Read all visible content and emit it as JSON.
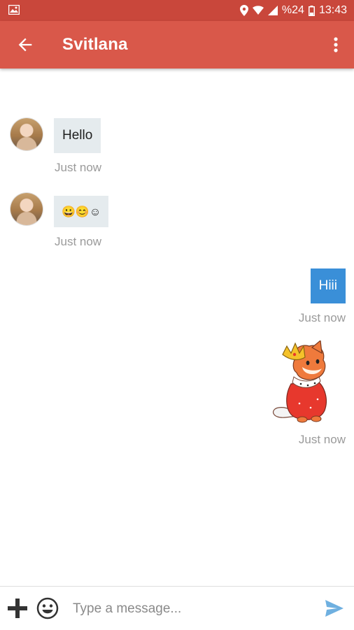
{
  "status_bar": {
    "battery": "%24",
    "time": "13:43"
  },
  "header": {
    "title": "Svitlana"
  },
  "messages": [
    {
      "direction": "in",
      "text": "Hello",
      "time": "Just now"
    },
    {
      "direction": "in",
      "text": "😀😊☺",
      "time": "Just now"
    },
    {
      "direction": "out",
      "text": "Hiii",
      "time": "Just now"
    },
    {
      "direction": "out",
      "type": "sticker",
      "sticker": "fox-king-sticker",
      "time": "Just now"
    }
  ],
  "composer": {
    "placeholder": "Type a message..."
  },
  "colors": {
    "status_bar": "#c9473b",
    "app_bar": "#d9584a",
    "incoming_bubble": "#e5ebee",
    "outgoing_bubble": "#3a8fd8",
    "send_icon": "#6fb0e0"
  }
}
